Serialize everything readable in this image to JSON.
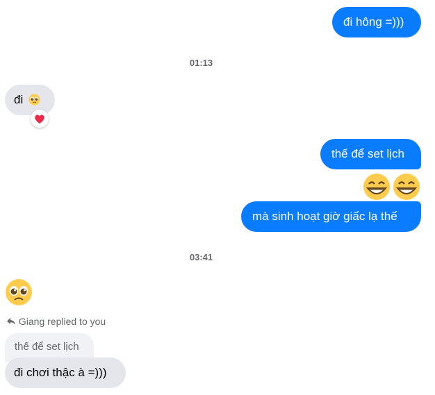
{
  "messages": {
    "m1": "đi hông =)))",
    "t1": "01:13",
    "m2": "đi",
    "m3": "thế để set lịch",
    "m5": "mà sinh hoạt giờ giấc lạ thế",
    "t2": "03:41",
    "reply_info": "Giang replied to you",
    "quoted": "thế để set lịch",
    "m7": "đi chơi thậc à =)))"
  },
  "icons": {
    "pleading": "pleading-face-emoji",
    "heart": "heart-reaction",
    "grin": "grinning-face-emoji",
    "reply": "reply-arrow-icon"
  },
  "colors": {
    "outgoing": "#0a7cff",
    "incoming": "#e4e6eb",
    "quoted": "#f0f2f5",
    "meta": "#65676b"
  }
}
